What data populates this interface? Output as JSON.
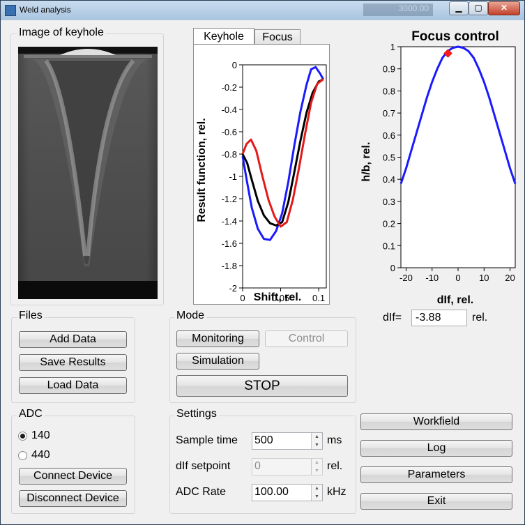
{
  "window": {
    "title": "Weld analysis",
    "background_title": "3000.00"
  },
  "keyhole": {
    "title": "Image of keyhole"
  },
  "plot_tabs": [
    {
      "label": "Keyhole"
    },
    {
      "label": "Focus"
    }
  ],
  "result_plot": {
    "ylabel": "Result function, rel.",
    "xlabel": "Shift, rel.",
    "yticks": [
      "0",
      "-0.2",
      "-0.4",
      "-0.6",
      "-0.8",
      "-1",
      "-1.2",
      "-1.4",
      "-1.6",
      "-1.8",
      "-2"
    ],
    "xticks": [
      "0",
      "0.05",
      "0.1"
    ]
  },
  "focus_plot": {
    "title": "Focus control",
    "ylabel": "h/b, rel.",
    "xlabel": "dIf, rel.",
    "yticks": [
      "1",
      "0.9",
      "0.8",
      "0.7",
      "0.6",
      "0.5",
      "0.4",
      "0.3",
      "0.2",
      "0.1",
      "0"
    ],
    "xticks": [
      "-20",
      "-10",
      "0",
      "10",
      "20"
    ]
  },
  "chart_data": [
    {
      "type": "line",
      "xlabel": "Shift, rel.",
      "ylabel": "Result function, rel.",
      "xlim": [
        0,
        0.11
      ],
      "ylim": [
        -2,
        0
      ],
      "series": [
        {
          "color": "#1a1aff",
          "points": [
            [
              0,
              -0.82
            ],
            [
              0.005,
              -1.02
            ],
            [
              0.012,
              -1.28
            ],
            [
              0.02,
              -1.47
            ],
            [
              0.028,
              -1.56
            ],
            [
              0.036,
              -1.57
            ],
            [
              0.044,
              -1.49
            ],
            [
              0.052,
              -1.33
            ],
            [
              0.06,
              -1.05
            ],
            [
              0.068,
              -0.72
            ],
            [
              0.076,
              -0.42
            ],
            [
              0.084,
              -0.18
            ],
            [
              0.09,
              -0.04
            ],
            [
              0.096,
              -0.02
            ],
            [
              0.102,
              -0.08
            ],
            [
              0.106,
              -0.13
            ]
          ]
        },
        {
          "color": "#000000",
          "points": [
            [
              0,
              -0.8
            ],
            [
              0.006,
              -0.88
            ],
            [
              0.012,
              -1.03
            ],
            [
              0.02,
              -1.22
            ],
            [
              0.028,
              -1.35
            ],
            [
              0.036,
              -1.42
            ],
            [
              0.044,
              -1.44
            ],
            [
              0.052,
              -1.41
            ],
            [
              0.06,
              -1.23
            ],
            [
              0.068,
              -0.96
            ],
            [
              0.076,
              -0.68
            ],
            [
              0.084,
              -0.43
            ],
            [
              0.092,
              -0.25
            ],
            [
              0.1,
              -0.15
            ],
            [
              0.106,
              -0.13
            ]
          ]
        },
        {
          "color": "#e21a1a",
          "points": [
            [
              0,
              -0.8
            ],
            [
              0.005,
              -0.71
            ],
            [
              0.011,
              -0.67
            ],
            [
              0.018,
              -0.77
            ],
            [
              0.026,
              -1.0
            ],
            [
              0.034,
              -1.21
            ],
            [
              0.042,
              -1.36
            ],
            [
              0.05,
              -1.45
            ],
            [
              0.058,
              -1.41
            ],
            [
              0.066,
              -1.21
            ],
            [
              0.074,
              -0.93
            ],
            [
              0.082,
              -0.62
            ],
            [
              0.09,
              -0.34
            ],
            [
              0.098,
              -0.17
            ],
            [
              0.106,
              -0.13
            ]
          ]
        }
      ]
    },
    {
      "type": "line",
      "title": "Focus control",
      "xlabel": "dIf, rel.",
      "ylabel": "h/b, rel.",
      "xlim": [
        -22,
        22
      ],
      "ylim": [
        0,
        1
      ],
      "series": [
        {
          "color": "#1a1aff",
          "points": [
            [
              -22,
              0.38
            ],
            [
              -20,
              0.45
            ],
            [
              -18,
              0.53
            ],
            [
              -16,
              0.61
            ],
            [
              -14,
              0.69
            ],
            [
              -12,
              0.77
            ],
            [
              -10,
              0.84
            ],
            [
              -8,
              0.9
            ],
            [
              -6,
              0.95
            ],
            [
              -4,
              0.98
            ],
            [
              -2,
              0.995
            ],
            [
              0,
              1.0
            ],
            [
              2,
              0.995
            ],
            [
              4,
              0.98
            ],
            [
              6,
              0.95
            ],
            [
              8,
              0.9
            ],
            [
              10,
              0.84
            ],
            [
              12,
              0.77
            ],
            [
              14,
              0.69
            ],
            [
              16,
              0.61
            ],
            [
              18,
              0.53
            ],
            [
              20,
              0.45
            ],
            [
              22,
              0.38
            ]
          ]
        }
      ],
      "marker": {
        "x": -3.88,
        "y": 0.97,
        "color": "#ff1a1a"
      }
    }
  ],
  "dif": {
    "label": "dIf=",
    "value": "-3.88",
    "unit": "rel."
  },
  "files": {
    "title": "Files",
    "add": "Add Data",
    "save": "Save Results",
    "load": "Load Data"
  },
  "mode": {
    "title": "Mode",
    "monitoring": "Monitoring",
    "control": "Control",
    "simulation": "Simulation",
    "stop": "STOP"
  },
  "adc": {
    "title": "ADC",
    "options": [
      "140",
      "440"
    ],
    "selected": "140",
    "connect": "Connect Device",
    "disconnect": "Disconnect Device"
  },
  "settings": {
    "title": "Settings",
    "sample_time": {
      "label": "Sample time",
      "value": "500",
      "unit": "ms"
    },
    "dif_setpoint": {
      "label": "dIf setpoint",
      "value": "0",
      "unit": "rel."
    },
    "adc_rate": {
      "label": "ADC Rate",
      "value": "100.00",
      "unit": "kHz"
    }
  },
  "side_buttons": {
    "workfield": "Workfield",
    "log": "Log",
    "parameters": "Parameters",
    "exit": "Exit"
  }
}
